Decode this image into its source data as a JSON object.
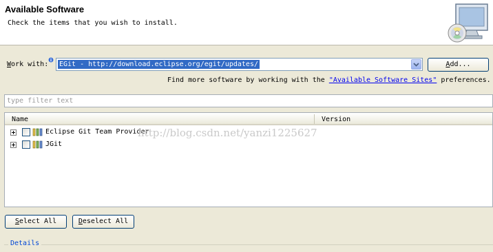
{
  "header": {
    "title": "Available Software",
    "description": "Check the items that you wish to install."
  },
  "work_with": {
    "label_mnemonic": "W",
    "label_rest": "ork with:",
    "value": "EGit - http://download.eclipse.org/egit/updates/",
    "add_mnemonic": "A",
    "add_rest": "dd..."
  },
  "find_more": {
    "prefix": "Find more software by working with the ",
    "link": "\"Available Software Sites\"",
    "suffix": " preferences."
  },
  "filter": {
    "placeholder": "type filter text"
  },
  "table": {
    "columns": [
      "Name",
      "Version"
    ],
    "rows": [
      {
        "name": "Eclipse Git Team Provider",
        "version": "",
        "checked": false,
        "expanded": false
      },
      {
        "name": "JGit",
        "version": "",
        "checked": false,
        "expanded": false
      }
    ]
  },
  "watermark": "http://blog.csdn.net/yanzi1225627",
  "buttons": {
    "select_all_mnemonic": "S",
    "select_all_rest": "elect All",
    "deselect_all_mnemonic": "D",
    "deselect_all_rest": "eselect All"
  },
  "details": {
    "label": "Details"
  },
  "colors": {
    "selection": "#316ac5",
    "link": "#0000ee",
    "group_label": "#0046d5",
    "dialog_bg": "#ece9d8"
  },
  "icons": [
    "info-icon",
    "dropdown-arrow-icon",
    "install-cd-monitor-icon",
    "expand-icon",
    "checkbox-icon",
    "feature-icon"
  ]
}
